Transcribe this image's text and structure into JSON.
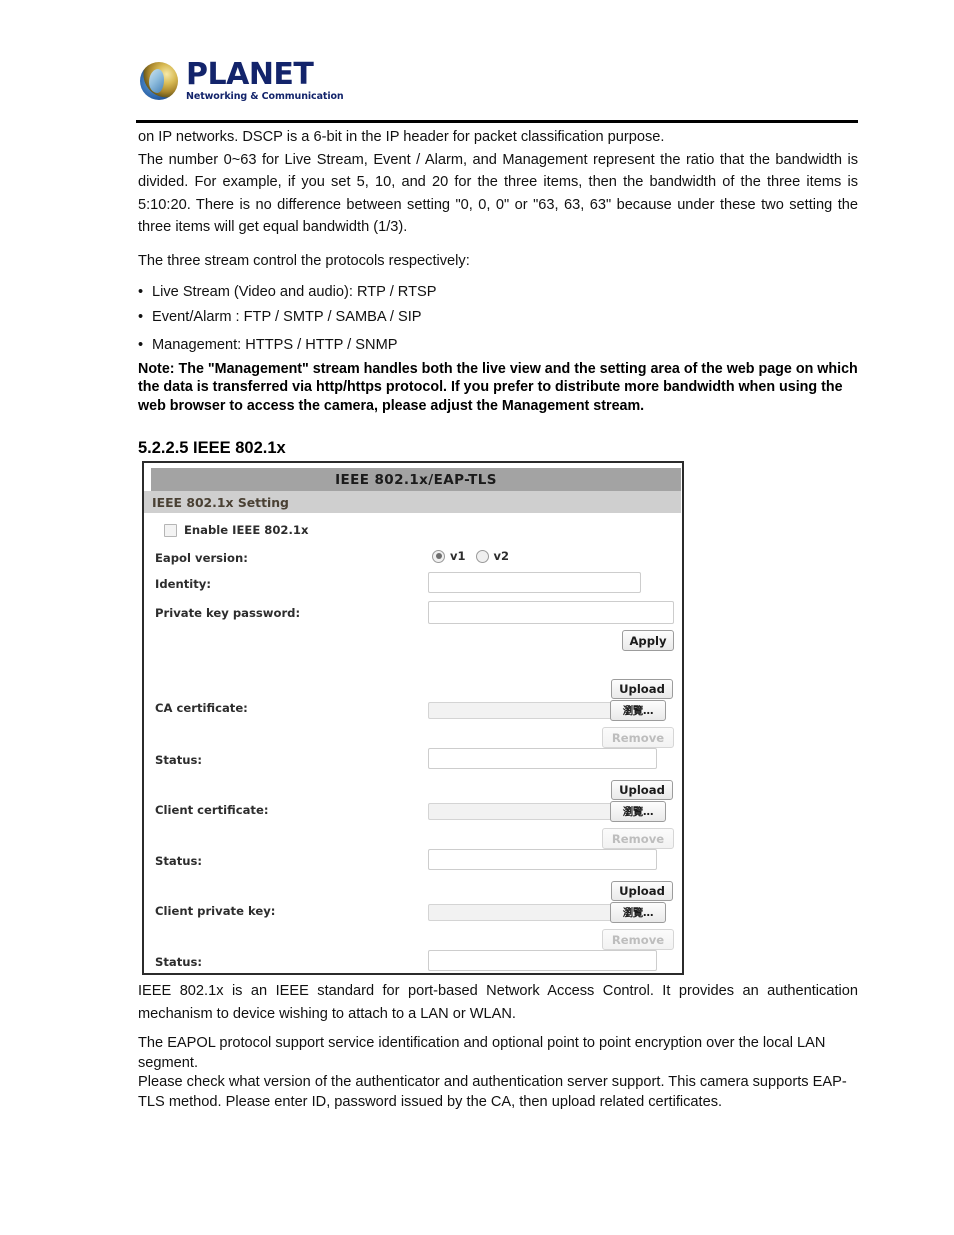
{
  "brand": {
    "name": "PLANET",
    "tagline": "Networking & Communication",
    "logo_icon": "planet-globe-icon",
    "brand_color": "#13246b"
  },
  "body": {
    "paragraph_1": "on IP networks. DSCP is a 6-bit in the IP header for packet classification purpose.",
    "paragraph_2": "The number 0~63 for Live Stream, Event / Alarm, and Management represent the ratio that the bandwidth is divided. For example, if you set 5, 10, and 20 for the three items, then the bandwidth of the three items is 5:10:20. There is no difference between setting \"0, 0, 0\" or \"63, 63, 63\" because under these two setting the three items will get equal bandwidth (1/3).",
    "paragraph_3": "The three stream control the protocols respectively:",
    "bullets": [
      "Live Stream (Video and audio): RTP / RTSP",
      "Event/Alarm : FTP /  SMTP /   SAMBA  /   SIP",
      "Management: HTTPS / HTTP / SNMP"
    ],
    "note": "Note: The \"Management\" stream handles both the live view and the setting area of the web page on which the data is transferred via http/https protocol. If you prefer to distribute more bandwidth when using the web browser to access the camera, please adjust the Management stream."
  },
  "section": {
    "heading": "5.2.2.5 IEEE 802.1x"
  },
  "panel": {
    "title": "IEEE 802.1x/EAP-TLS",
    "subtitle": "IEEE 802.1x Setting",
    "enable_checkbox_label": "Enable IEEE 802.1x",
    "enable_checkbox_checked": false,
    "eapol": {
      "label": "Eapol version:",
      "options": [
        "v1",
        "v2"
      ],
      "selected": "v1"
    },
    "identity": {
      "label": "Identity:",
      "value": ""
    },
    "private_key_password": {
      "label": "Private key password:",
      "value": ""
    },
    "apply_button": "Apply",
    "upload_button": "Upload",
    "browse_button": "瀏覽...",
    "remove_button": "Remove",
    "status_label": "Status:",
    "ca_certificate": {
      "label": "CA certificate:",
      "file_value": "",
      "status_value": ""
    },
    "client_certificate": {
      "label": "Client certificate:",
      "file_value": "",
      "status_value": ""
    },
    "client_private_key": {
      "label": "Client private key:",
      "file_value": "",
      "status_value": ""
    },
    "colors": {
      "title_bar": "#a3a3a3",
      "sub_bar": "#cfcfcf",
      "border": "#2b2b2b"
    }
  },
  "footer": {
    "paragraph_1": "IEEE 802.1x is an IEEE standard for port-based Network Access Control. It provides an authentication mechanism to device wishing to attach to a LAN or WLAN.",
    "paragraph_2": "The EAPOL protocol support service identification and optional point to point encryption over the local LAN segment.",
    "paragraph_3": "Please check what version of the authenticator and authentication server support. This camera supports EAP-TLS method. Please enter ID, password issued by the CA, then upload related certificates."
  }
}
